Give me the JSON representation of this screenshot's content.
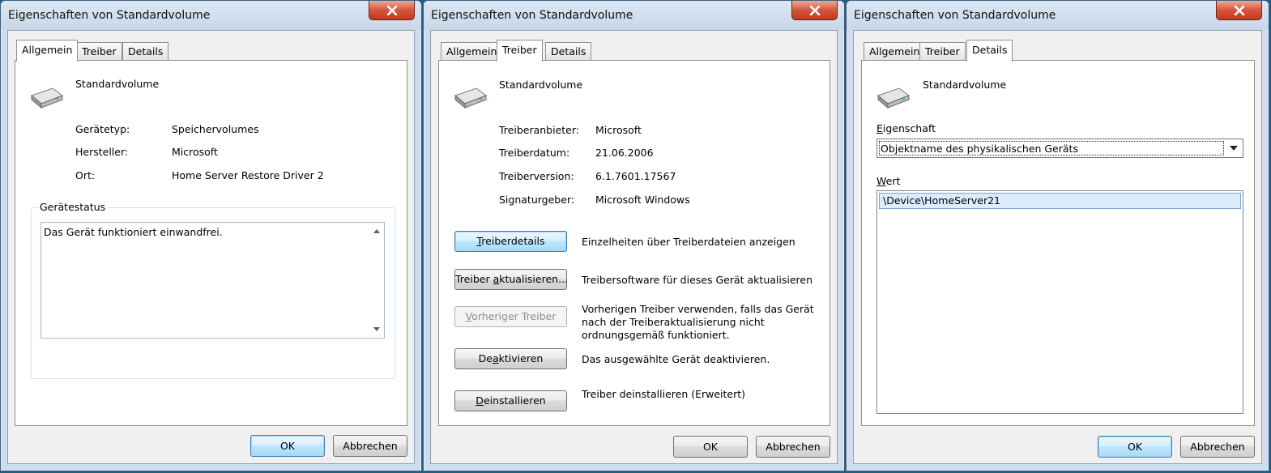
{
  "dialog_title": "Eigenschaften von Standardvolume",
  "tabs": {
    "general": "Allgemein",
    "driver": "Treiber",
    "details": "Details"
  },
  "device_name": "Standardvolume",
  "general": {
    "fields": [
      {
        "label": "Gerätetyp:",
        "value": "Speichervolumes"
      },
      {
        "label": "Hersteller:",
        "value": "Microsoft"
      },
      {
        "label": "Ort:",
        "value": "Home Server Restore Driver 2"
      }
    ],
    "status_group_label": "Gerätestatus",
    "status_text": "Das Gerät funktioniert einwandfrei."
  },
  "driver": {
    "fields": [
      {
        "label": "Treiberanbieter:",
        "value": "Microsoft"
      },
      {
        "label": "Treiberdatum:",
        "value": "21.06.2006"
      },
      {
        "label": "Treiberversion:",
        "value": "6.1.7601.17567"
      },
      {
        "label": "Signaturgeber:",
        "value": "Microsoft Windows"
      }
    ],
    "actions": [
      {
        "pre": "",
        "key": "T",
        "post": "reiberdetails",
        "desc": "Einzelheiten über Treiberdateien anzeigen"
      },
      {
        "pre": "Treiber ",
        "key": "a",
        "post": "ktualisieren...",
        "desc": "Treibersoftware für dieses Gerät aktualisieren"
      },
      {
        "pre": "",
        "key": "V",
        "post": "orheriger Treiber",
        "desc": "Vorherigen Treiber verwenden, falls das Gerät nach der Treiberaktualisierung nicht ordnungsgemäß funktioniert."
      },
      {
        "pre": "De",
        "key": "a",
        "post": "ktivieren",
        "desc": "Das ausgewählte Gerät deaktivieren."
      },
      {
        "pre": "",
        "key": "D",
        "post": "einstallieren",
        "desc": "Treiber deinstallieren (Erweitert)"
      }
    ]
  },
  "details": {
    "property_label_key": "E",
    "property_label_rest": "igenschaft",
    "property_selected": "Objektname des physikalischen Geräts",
    "value_label_key": "W",
    "value_label_rest": "ert",
    "value_entry": "\\Device\\HomeServer21"
  },
  "buttons": {
    "ok": "OK",
    "cancel": "Abbrechen"
  }
}
